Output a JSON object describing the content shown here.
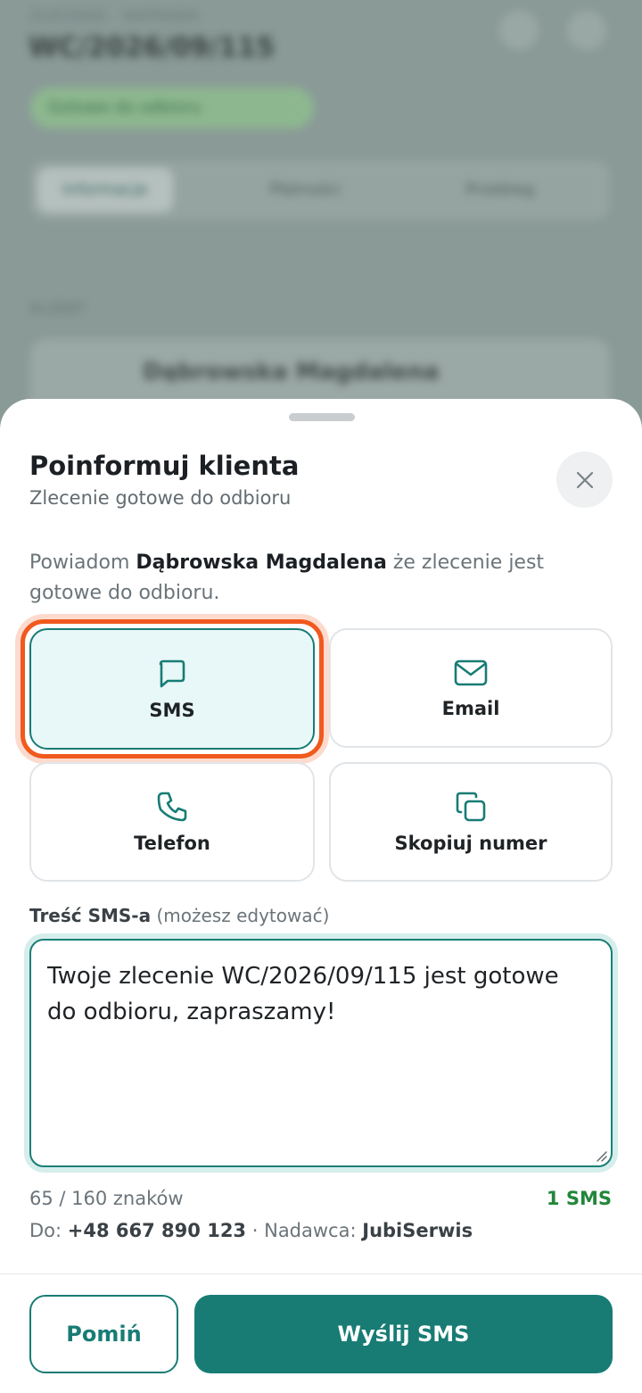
{
  "background": {
    "breadcrumb": "ZLECENIE · NAPRAWA",
    "order_number": "WC/2026/09/115",
    "status_label": "Gotowe do odbioru",
    "tabs": [
      {
        "label": "Informacje"
      },
      {
        "label": "Płatności"
      },
      {
        "label": "Przebieg"
      }
    ],
    "section_label": "KLIENT",
    "client_name": "Dąbrowska Magdalena"
  },
  "sheet": {
    "title": "Poinformuj klienta",
    "subtitle": "Zlecenie gotowe do odbioru",
    "intro_prefix": "Powiadom",
    "client_name": "Dąbrowska Magdalena",
    "intro_suffix": "że zlecenie jest gotowe do odbioru.",
    "options": [
      {
        "label": "SMS",
        "icon": "message-icon",
        "selected": true
      },
      {
        "label": "Email",
        "icon": "mail-icon",
        "selected": false
      },
      {
        "label": "Telefon",
        "icon": "phone-icon",
        "selected": false
      },
      {
        "label": "Skopiuj numer",
        "icon": "copy-icon",
        "selected": false
      }
    ],
    "message_label": "Treść SMS-a",
    "message_hint": "(możesz edytować)",
    "message_text": "Twoje zlecenie WC/2026/09/115 jest gotowe do odbioru, zapraszamy!",
    "char_counter": "65 / 160 znaków",
    "sms_count": "1 SMS",
    "to_label": "Do:",
    "phone": "+48 667 890 123",
    "separator": "·",
    "sender_label": "Nadawca:",
    "sender": "JubiSerwis",
    "skip_label": "Pomiń",
    "send_label": "Wyślij SMS"
  },
  "colors": {
    "accent": "#187c75",
    "highlight": "#f05a1e",
    "sms_count": "#22863a"
  }
}
